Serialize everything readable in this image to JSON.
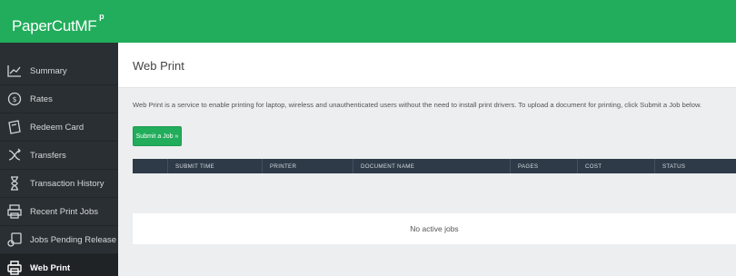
{
  "app": {
    "logo_main": "PaperCut",
    "logo_suffix": "MF",
    "logo_mark": "p"
  },
  "colors": {
    "brand_green": "#21ad5b",
    "sidebar_bg": "#2a2f33",
    "table_header_bg": "#2e3a48"
  },
  "sidebar": {
    "items": [
      {
        "label": "Summary",
        "icon": "chart-icon",
        "active": false
      },
      {
        "label": "Rates",
        "icon": "dollar-circle-icon",
        "active": false
      },
      {
        "label": "Redeem Card",
        "icon": "card-icon",
        "active": false
      },
      {
        "label": "Transfers",
        "icon": "transfer-icon",
        "active": false
      },
      {
        "label": "Transaction History",
        "icon": "hourglass-icon",
        "active": false
      },
      {
        "label": "Recent Print Jobs",
        "icon": "recent-print-icon",
        "active": false
      },
      {
        "label": "Jobs Pending Release",
        "icon": "pending-release-icon",
        "active": false
      },
      {
        "label": "Web Print",
        "icon": "printer-icon",
        "active": true
      }
    ]
  },
  "main": {
    "title": "Web Print",
    "intro": "Web Print is a service to enable printing for laptop, wireless and unauthenticated users without the need to install print drivers. To upload a document for printing, click Submit a Job below.",
    "submit_label": "Submit a Job »",
    "table": {
      "columns": [
        "",
        "SUBMIT TIME",
        "PRINTER",
        "DOCUMENT NAME",
        "PAGES",
        "COST",
        "STATUS"
      ],
      "empty_message": "No active jobs"
    }
  }
}
